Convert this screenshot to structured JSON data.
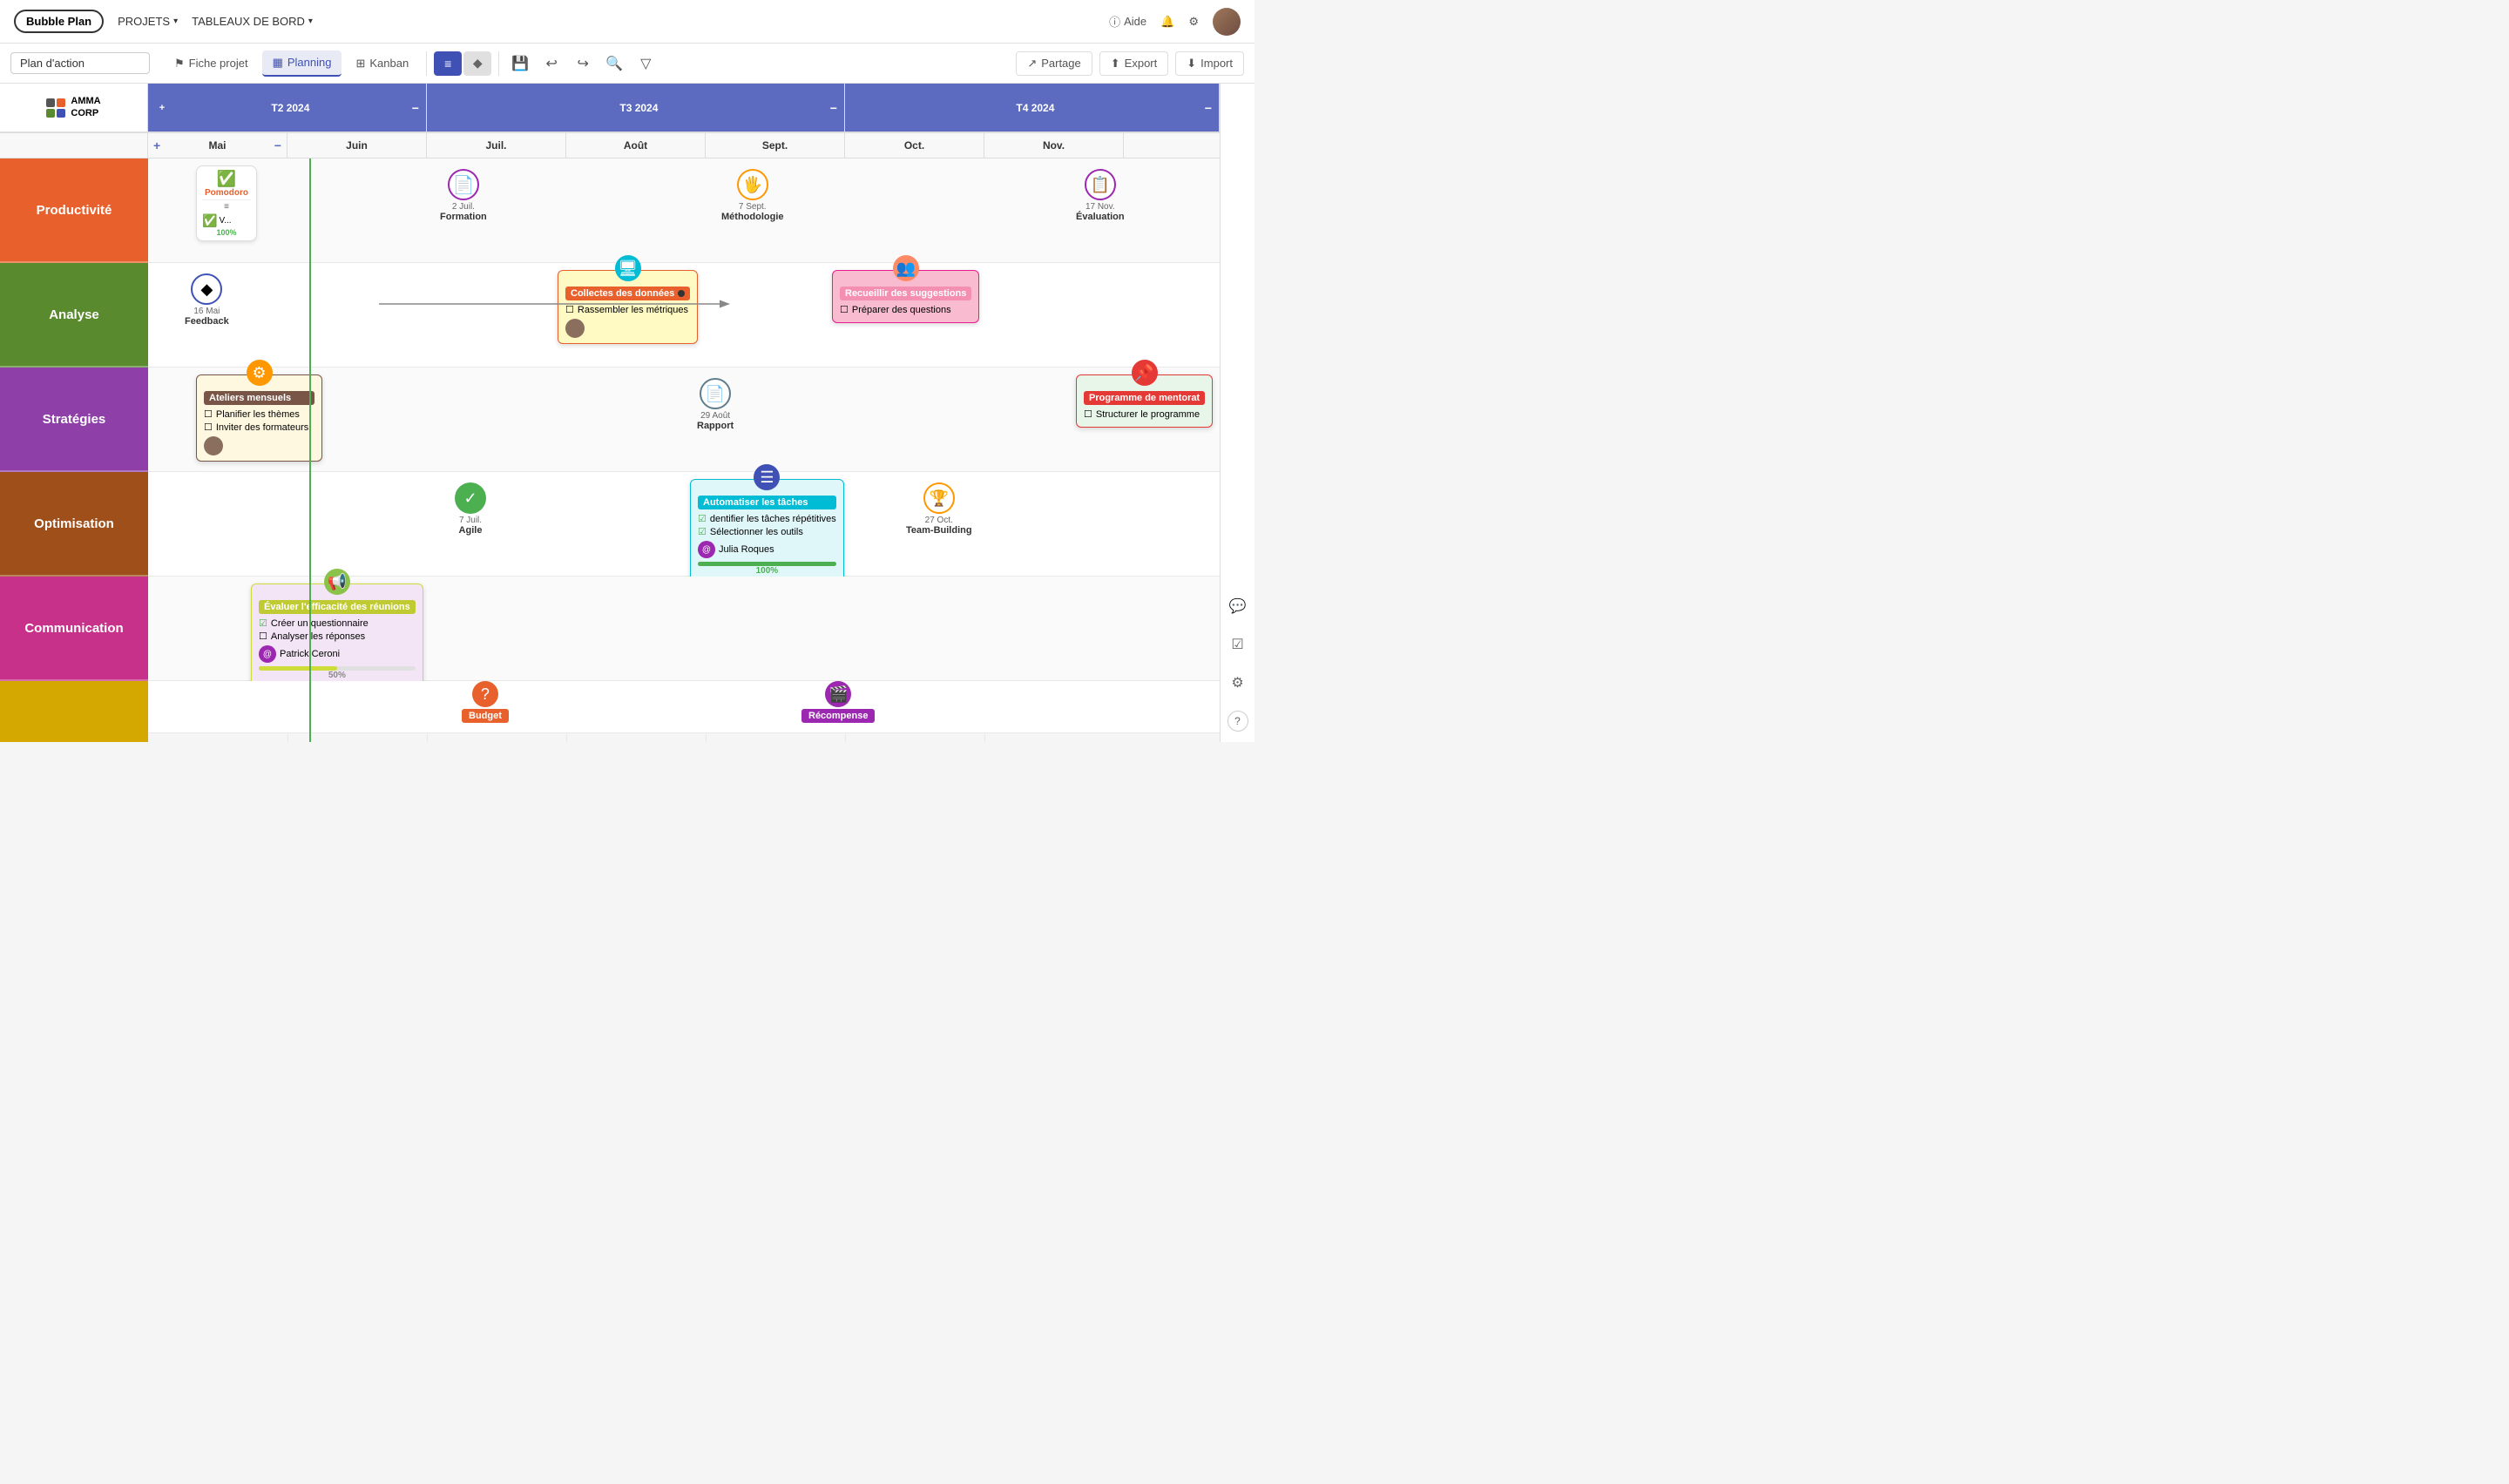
{
  "app": {
    "title": "Bubble Plan"
  },
  "nav": {
    "logo": "Bubble Plan",
    "items": [
      {
        "label": "PROJETS",
        "arrow": "▾"
      },
      {
        "label": "TABLEAUX DE BORD",
        "arrow": "▾"
      }
    ],
    "right": {
      "aide": "Aide",
      "bell": "🔔",
      "settings": "⚙"
    }
  },
  "toolbar": {
    "project_name": "Plan d'action",
    "project_name_placeholder": "Plan d'action",
    "fiche_projet": "Fiche projet",
    "planning": "Planning",
    "kanban": "Kanban",
    "partage": "Partage",
    "export": "Export",
    "import": "Import"
  },
  "timeline": {
    "quarters": [
      {
        "label": "T2 2024",
        "span": "q2"
      },
      {
        "label": "T3 2024",
        "span": "q3"
      },
      {
        "label": "T4 2024",
        "span": "q4"
      }
    ],
    "months": [
      "Mai",
      "Juin",
      "Juil.",
      "Août",
      "Sept.",
      "Oct.",
      "Nov."
    ]
  },
  "categories": [
    {
      "label": "Productivité",
      "color": "#e8602c"
    },
    {
      "label": "Analyse",
      "color": "#5a8a2e"
    },
    {
      "label": "Stratégies",
      "color": "#8e3fa8"
    },
    {
      "label": "Optimisation",
      "color": "#9e4f1a"
    },
    {
      "label": "Communication",
      "color": "#c8318a"
    },
    {
      "label": "",
      "color": "#d4a800"
    }
  ],
  "items": {
    "productivite": {
      "pomodoro": {
        "icon": "✅",
        "label": "Pomodoro",
        "sublabel": "V...",
        "progress": "100%"
      },
      "formation": {
        "date": "2 Juil.",
        "label": "Formation"
      },
      "methodologie": {
        "date": "7 Sept.",
        "label": "Méthodologie"
      },
      "evaluation": {
        "date": "17 Nov.",
        "label": "Évaluation"
      }
    },
    "analyse": {
      "feedback": {
        "date": "16 Mai",
        "label": "Feedback"
      },
      "collecte": {
        "label": "Collectes des données",
        "tasks": [
          "Rassembler les métriques"
        ],
        "has_avatar": true
      },
      "recueillir": {
        "label": "Recueillir des suggestions",
        "tasks": [
          "Préparer des questions"
        ]
      }
    },
    "strategies": {
      "ateliers": {
        "label": "Ateliers mensuels",
        "tasks": [
          "Planifier les thèmes",
          "Inviter des formateurs"
        ],
        "has_avatar": true
      },
      "rapport": {
        "date": "29 Août",
        "label": "Rapport"
      },
      "programme": {
        "label": "Programme de mentorat",
        "tasks": [
          "Structurer le programme"
        ]
      }
    },
    "optimisation": {
      "agile": {
        "date": "7 Juil.",
        "label": "Agile"
      },
      "automatiser": {
        "label": "Automatiser les tâches",
        "tasks": [
          "dentifier les tâches répétitives",
          "Sélectionner les outils"
        ],
        "assignee": "Julia Roques",
        "progress": 100
      },
      "teambuilding": {
        "date": "27 Oct.",
        "label": "Team-Building"
      }
    },
    "communication": {
      "evaluer": {
        "label": "Évaluer l'efficacité des réunions",
        "tasks_checked": [
          "Créer un questionnaire"
        ],
        "tasks_unchecked": [
          "Analyser les réponses"
        ],
        "assignee": "Patrick Ceroni",
        "progress": 50
      }
    },
    "bottom": {
      "budget": {
        "label": "Budget"
      },
      "recompense": {
        "label": "Récompense"
      }
    }
  },
  "right_panel": {
    "chat_icon": "💬",
    "check_icon": "☑",
    "settings_icon": "⚙",
    "help_icon": "?"
  }
}
